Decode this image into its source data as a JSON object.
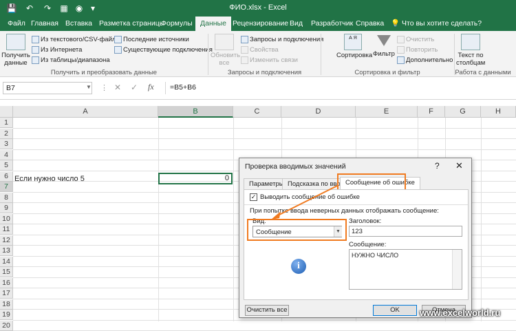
{
  "titlebar": {
    "title": "ФИО.xlsx  -  Excel",
    "icons": [
      "save-icon",
      "undo-icon",
      "redo-icon",
      "print-preview-icon",
      "camera-icon",
      "customize-icon"
    ]
  },
  "tabs": [
    "Файл",
    "Главная",
    "Вставка",
    "Разметка страницы",
    "Формулы",
    "Данные",
    "Рецензирование",
    "Вид",
    "Разработчик",
    "Справка"
  ],
  "active_tab": "Данные",
  "tellme": "Что вы хотите сделать?",
  "ribbon": {
    "get_data": "Получить данные",
    "from_csv": "Из текстового/CSV-файла",
    "from_web": "Из Интернета",
    "from_table": "Из таблицы/диапазона",
    "recent": "Последние источники",
    "existing": "Существующие подключения",
    "group1": "Получить и преобразовать данные",
    "refresh_all": "Обновить все",
    "queries": "Запросы и подключения",
    "props": "Свойства",
    "edit_links": "Изменить связи",
    "group2": "Запросы и подключения",
    "sort_az": "А Я",
    "sort": "Сортировка",
    "filter": "Фильтр",
    "clear": "Очистить",
    "reapply": "Повторить",
    "advanced": "Дополнительно",
    "group3": "Сортировка и фильтр",
    "text_to_cols": "Текст по столбцам",
    "group4": "Работа с данными"
  },
  "formula_bar": {
    "name_box": "B7",
    "formula": "=B5+B6"
  },
  "columns": [
    "A",
    "B",
    "C",
    "D",
    "E",
    "F",
    "G",
    "H"
  ],
  "rows": [
    "1",
    "2",
    "3",
    "4",
    "5",
    "6",
    "7",
    "8",
    "9",
    "10",
    "11",
    "12",
    "13",
    "14",
    "15",
    "16",
    "17",
    "18",
    "19",
    "20"
  ],
  "cells": {
    "A7": "Если нужно число 5",
    "B7": "0"
  },
  "dialog": {
    "title": "Проверка вводимых значений",
    "help": "?",
    "close": "✕",
    "tabs": [
      "Параметры",
      "Подсказка по вводу",
      "Сообщение об ошибке"
    ],
    "show_error_label": "Выводить сообщение об ошибке",
    "show_error_checked": true,
    "instruction": "При попытке ввода неверных данных отображать сообщение:",
    "style_label": "Вид:",
    "style_value": "Сообщение",
    "title_label": "Заголовок:",
    "title_value": "123",
    "message_label": "Сообщение:",
    "message_value": "НУЖНО ЧИСЛО",
    "clear_all": "Очистить все",
    "ok": "OK",
    "cancel": "Отмена"
  },
  "watermark": "www.excelworld.ru",
  "colors": {
    "excel_green": "#217346",
    "highlight": "#f07a1f",
    "info_blue": "#1e5fb4"
  }
}
